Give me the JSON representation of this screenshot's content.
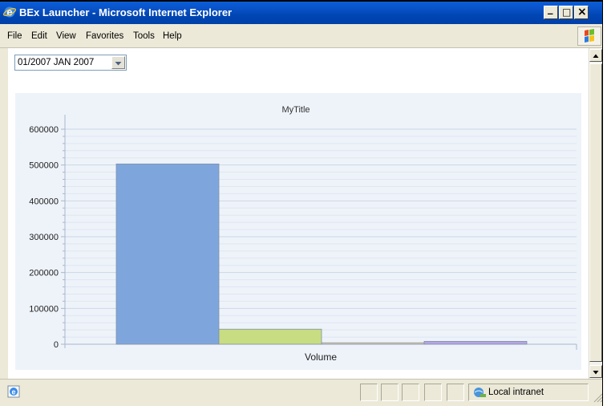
{
  "window": {
    "title": "BEx Launcher - Microsoft Internet Explorer",
    "minimize_glyph": "_",
    "maximize_glyph": "□",
    "close_glyph": "×"
  },
  "menu": {
    "items": [
      {
        "label": "File"
      },
      {
        "label": "Edit"
      },
      {
        "label": "View"
      },
      {
        "label": "Favorites"
      },
      {
        "label": "Tools"
      },
      {
        "label": "Help"
      }
    ]
  },
  "filter": {
    "selected": "01/2007 JAN 2007"
  },
  "status": {
    "zone": "Local intranet"
  },
  "colors": {
    "titlebar": "#0a53c8",
    "chart_background": "#eef3fa"
  },
  "chart_data": {
    "type": "bar",
    "title": "MyTitle",
    "xlabel": "Volume",
    "ylabel": "",
    "ylim": [
      0,
      600000
    ],
    "yticks": [
      0,
      100000,
      200000,
      300000,
      400000,
      500000,
      600000
    ],
    "yticklabels": [
      "0",
      "100000",
      "200000",
      "300000",
      "400000",
      "500000",
      "600000"
    ],
    "categories": [
      "Volume"
    ],
    "series": [
      {
        "values": [
          503000
        ],
        "color": "#7fa6dc"
      },
      {
        "values": [
          42000
        ],
        "color": "#c8dc82"
      },
      {
        "values": [
          4000
        ],
        "color": "#ead7a6"
      },
      {
        "values": [
          8000
        ],
        "color": "#b4a6e1"
      }
    ],
    "grid": true,
    "legend": "none"
  }
}
